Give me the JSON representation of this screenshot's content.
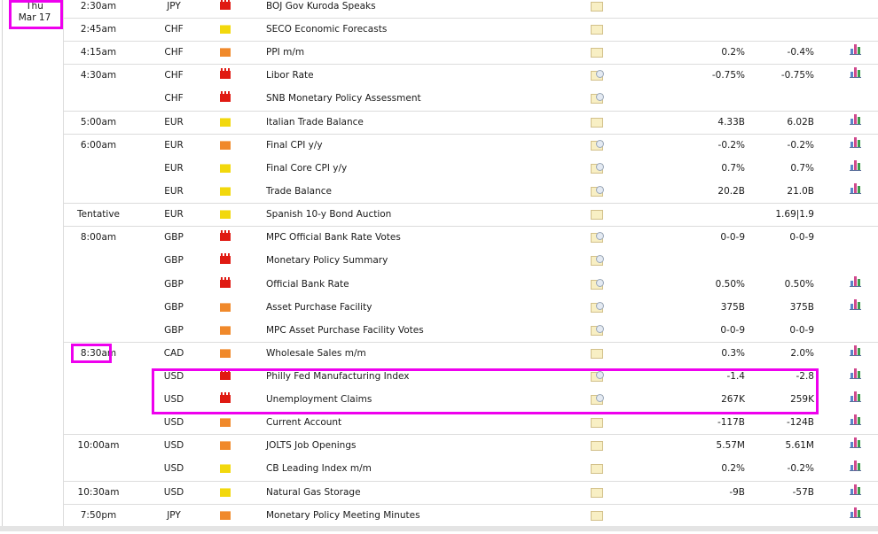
{
  "date": {
    "weekday": "Thu",
    "month_day": "Mar 17"
  },
  "rows": [
    {
      "time": "2:30am",
      "currency": "JPY",
      "impact": "high",
      "event": "BOJ Gov Kuroda Speaks",
      "doc_icon": "folder-icon",
      "actual": "",
      "forecast": "",
      "chart": false,
      "sep_before": false
    },
    {
      "time": "2:45am",
      "currency": "CHF",
      "impact": "low",
      "event": "SECO Economic Forecasts",
      "doc_icon": "folder-icon",
      "actual": "",
      "forecast": "",
      "chart": false,
      "sep_before": true
    },
    {
      "time": "4:15am",
      "currency": "CHF",
      "impact": "medium",
      "event": "PPI m/m",
      "doc_icon": "folder-icon",
      "actual": "0.2%",
      "forecast": "-0.4%",
      "chart": true,
      "sep_before": true
    },
    {
      "time": "4:30am",
      "currency": "CHF",
      "impact": "high",
      "event": "Libor Rate",
      "doc_icon": "folder-speaker-icon",
      "actual": "-0.75%",
      "forecast": "-0.75%",
      "chart": true,
      "sep_before": true
    },
    {
      "time": "",
      "currency": "CHF",
      "impact": "high",
      "event": "SNB Monetary Policy Assessment",
      "doc_icon": "folder-speaker-icon",
      "actual": "",
      "forecast": "",
      "chart": false,
      "sep_before": false
    },
    {
      "time": "5:00am",
      "currency": "EUR",
      "impact": "low",
      "event": "Italian Trade Balance",
      "doc_icon": "folder-icon",
      "actual": "4.33B",
      "forecast": "6.02B",
      "chart": true,
      "sep_before": true
    },
    {
      "time": "6:00am",
      "currency": "EUR",
      "impact": "medium",
      "event": "Final CPI y/y",
      "doc_icon": "folder-speaker-icon",
      "actual": "-0.2%",
      "forecast": "-0.2%",
      "chart": true,
      "sep_before": true
    },
    {
      "time": "",
      "currency": "EUR",
      "impact": "low",
      "event": "Final Core CPI y/y",
      "doc_icon": "folder-speaker-icon",
      "actual": "0.7%",
      "forecast": "0.7%",
      "chart": true,
      "sep_before": false
    },
    {
      "time": "",
      "currency": "EUR",
      "impact": "low",
      "event": "Trade Balance",
      "doc_icon": "folder-speaker-icon",
      "actual": "20.2B",
      "forecast": "21.0B",
      "chart": true,
      "sep_before": false
    },
    {
      "time": "Tentative",
      "currency": "EUR",
      "impact": "low",
      "event": "Spanish 10-y Bond Auction",
      "doc_icon": "folder-icon",
      "actual": "",
      "forecast": "1.69|1.9",
      "chart": false,
      "sep_before": true
    },
    {
      "time": "8:00am",
      "currency": "GBP",
      "impact": "high",
      "event": "MPC Official Bank Rate Votes",
      "doc_icon": "folder-speaker-icon",
      "actual": "0-0-9",
      "forecast": "0-0-9",
      "chart": false,
      "sep_before": true
    },
    {
      "time": "",
      "currency": "GBP",
      "impact": "high",
      "event": "Monetary Policy Summary",
      "doc_icon": "folder-speaker-icon",
      "actual": "",
      "forecast": "",
      "chart": false,
      "sep_before": false
    },
    {
      "time": "",
      "currency": "GBP",
      "impact": "high",
      "event": "Official Bank Rate",
      "doc_icon": "folder-speaker-icon",
      "actual": "0.50%",
      "forecast": "0.50%",
      "chart": true,
      "sep_before": false
    },
    {
      "time": "",
      "currency": "GBP",
      "impact": "medium",
      "event": "Asset Purchase Facility",
      "doc_icon": "folder-speaker-icon",
      "actual": "375B",
      "forecast": "375B",
      "chart": true,
      "sep_before": false
    },
    {
      "time": "",
      "currency": "GBP",
      "impact": "medium",
      "event": "MPC Asset Purchase Facility Votes",
      "doc_icon": "folder-speaker-icon",
      "actual": "0-0-9",
      "forecast": "0-0-9",
      "chart": false,
      "sep_before": false
    },
    {
      "time": "8:30am",
      "currency": "CAD",
      "impact": "medium",
      "event": "Wholesale Sales m/m",
      "doc_icon": "folder-icon",
      "actual": "0.3%",
      "forecast": "2.0%",
      "chart": true,
      "sep_before": true
    },
    {
      "time": "",
      "currency": "USD",
      "impact": "high",
      "event": "Philly Fed Manufacturing Index",
      "doc_icon": "folder-speaker-icon",
      "actual": "-1.4",
      "forecast": "-2.8",
      "chart": true,
      "sep_before": false
    },
    {
      "time": "",
      "currency": "USD",
      "impact": "high",
      "event": "Unemployment Claims",
      "doc_icon": "folder-speaker-icon",
      "actual": "267K",
      "forecast": "259K",
      "chart": true,
      "sep_before": false
    },
    {
      "time": "",
      "currency": "USD",
      "impact": "medium",
      "event": "Current Account",
      "doc_icon": "folder-icon",
      "actual": "-117B",
      "forecast": "-124B",
      "chart": true,
      "sep_before": false
    },
    {
      "time": "10:00am",
      "currency": "USD",
      "impact": "medium",
      "event": "JOLTS Job Openings",
      "doc_icon": "folder-icon",
      "actual": "5.57M",
      "forecast": "5.61M",
      "chart": true,
      "sep_before": true
    },
    {
      "time": "",
      "currency": "USD",
      "impact": "low",
      "event": "CB Leading Index m/m",
      "doc_icon": "folder-icon",
      "actual": "0.2%",
      "forecast": "-0.2%",
      "chart": true,
      "sep_before": false
    },
    {
      "time": "10:30am",
      "currency": "USD",
      "impact": "low",
      "event": "Natural Gas Storage",
      "doc_icon": "folder-icon",
      "actual": "-9B",
      "forecast": "-57B",
      "chart": true,
      "sep_before": true
    },
    {
      "time": "7:50pm",
      "currency": "JPY",
      "impact": "medium",
      "event": "Monetary Policy Meeting Minutes",
      "doc_icon": "folder-icon",
      "actual": "",
      "forecast": "",
      "chart": true,
      "sep_before": true
    }
  ],
  "colors": {
    "impact_high": "#e01a12",
    "impact_medium": "#f0892b",
    "impact_low": "#f2d80d",
    "highlight": "#ee00ee"
  }
}
